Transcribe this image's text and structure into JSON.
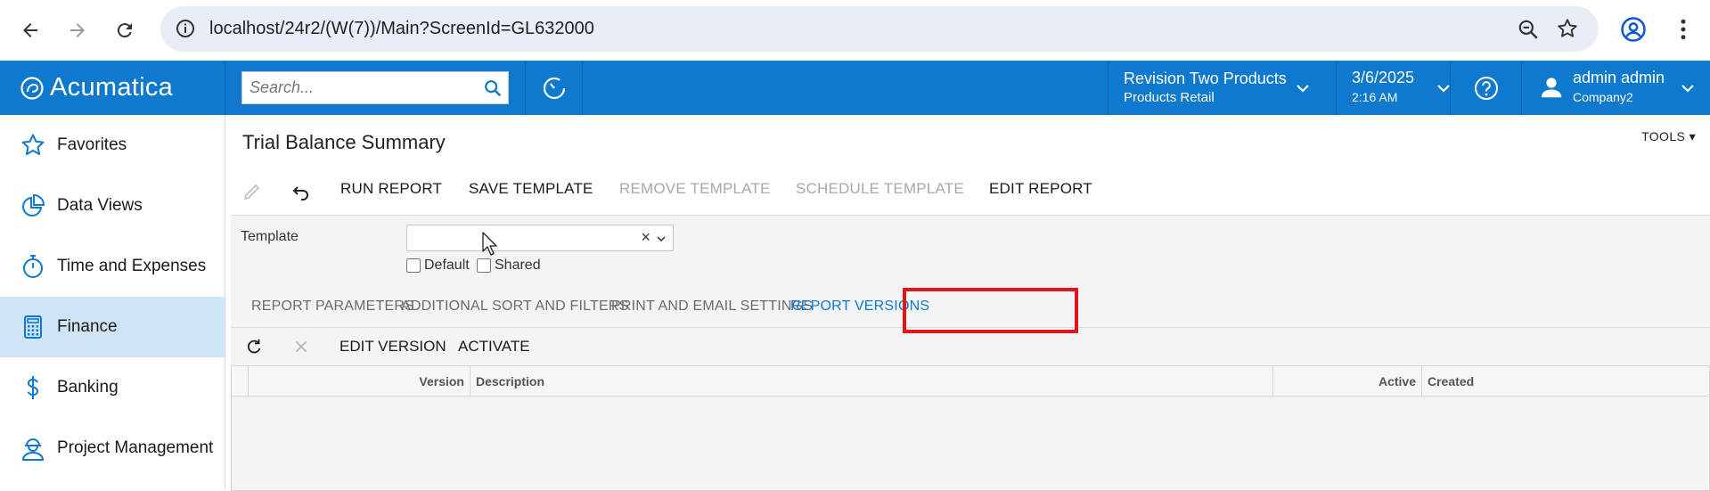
{
  "browser": {
    "url": "localhost/24r2/(W(7))/Main?ScreenId=GL632000"
  },
  "header": {
    "logo_text": "Acumatica",
    "search_placeholder": "Search...",
    "branch_name": "Revision Two Products",
    "branch_sub": "Products Retail",
    "date": "3/6/2025",
    "time": "2:16 AM",
    "user_name": "admin admin",
    "user_company": "Company2"
  },
  "sidebar": {
    "items": [
      {
        "label": "Favorites",
        "icon": "star-icon"
      },
      {
        "label": "Data Views",
        "icon": "pie-chart-icon"
      },
      {
        "label": "Time and Expenses",
        "icon": "stopwatch-icon"
      },
      {
        "label": "Finance",
        "icon": "calculator-icon",
        "active": true
      },
      {
        "label": "Banking",
        "icon": "dollar-icon"
      },
      {
        "label": "Project Management",
        "icon": "worker-icon"
      }
    ]
  },
  "main": {
    "title": "Trial Balance Summary",
    "tools_label": "TOOLS",
    "toolbar": {
      "run_report": "RUN REPORT",
      "save_template": "SAVE TEMPLATE",
      "remove_template": "REMOVE TEMPLATE",
      "schedule_template": "SCHEDULE TEMPLATE",
      "edit_report": "EDIT REPORT"
    },
    "form": {
      "template_label": "Template",
      "template_value": "",
      "default_label": "Default",
      "shared_label": "Shared"
    },
    "tabs": [
      {
        "label": "REPORT PARAMETERS"
      },
      {
        "label": "ADDITIONAL SORT AND FILTERS"
      },
      {
        "label": "PRINT AND EMAIL SETTINGS"
      },
      {
        "label": "REPORT VERSIONS",
        "active": true
      }
    ],
    "grid_toolbar": {
      "edit_version": "EDIT VERSION",
      "activate": "ACTIVATE"
    },
    "grid": {
      "columns": [
        "Version",
        "Description",
        "Active",
        "Created"
      ],
      "rows": []
    }
  },
  "colors": {
    "brand": "#0f79cd",
    "active_nav": "#cfe5f7",
    "highlight": "#e0161c"
  }
}
